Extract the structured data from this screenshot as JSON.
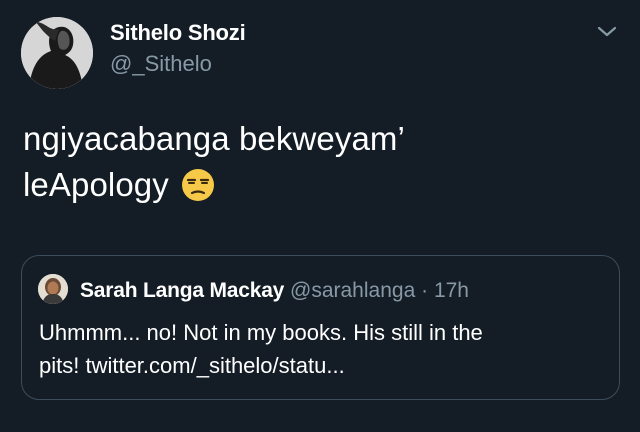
{
  "tweet": {
    "author": {
      "display_name": "Sithelo Shozi",
      "handle": "@_Sithelo",
      "avatar_icon": "profile-photo"
    },
    "menu_icon": "chevron-down-icon",
    "text_lines": [
      "ngiyacabanga bekweyam’",
      "leApology"
    ],
    "emoji": "unamused-face"
  },
  "quoted_tweet": {
    "author": {
      "display_name": "Sarah Langa Mackay",
      "handle": "@sarahlanga",
      "separator": "·",
      "time": "17h",
      "avatar_icon": "profile-photo"
    },
    "text_lines": [
      "Uhmmm... no! Not in my books. His still in the",
      "pits! twitter.com/_sithelo/statu..."
    ]
  },
  "colors": {
    "background": "#141d26",
    "text_primary": "#ffffff",
    "text_secondary": "#8899a6",
    "quote_border": "#3d4c5a"
  }
}
